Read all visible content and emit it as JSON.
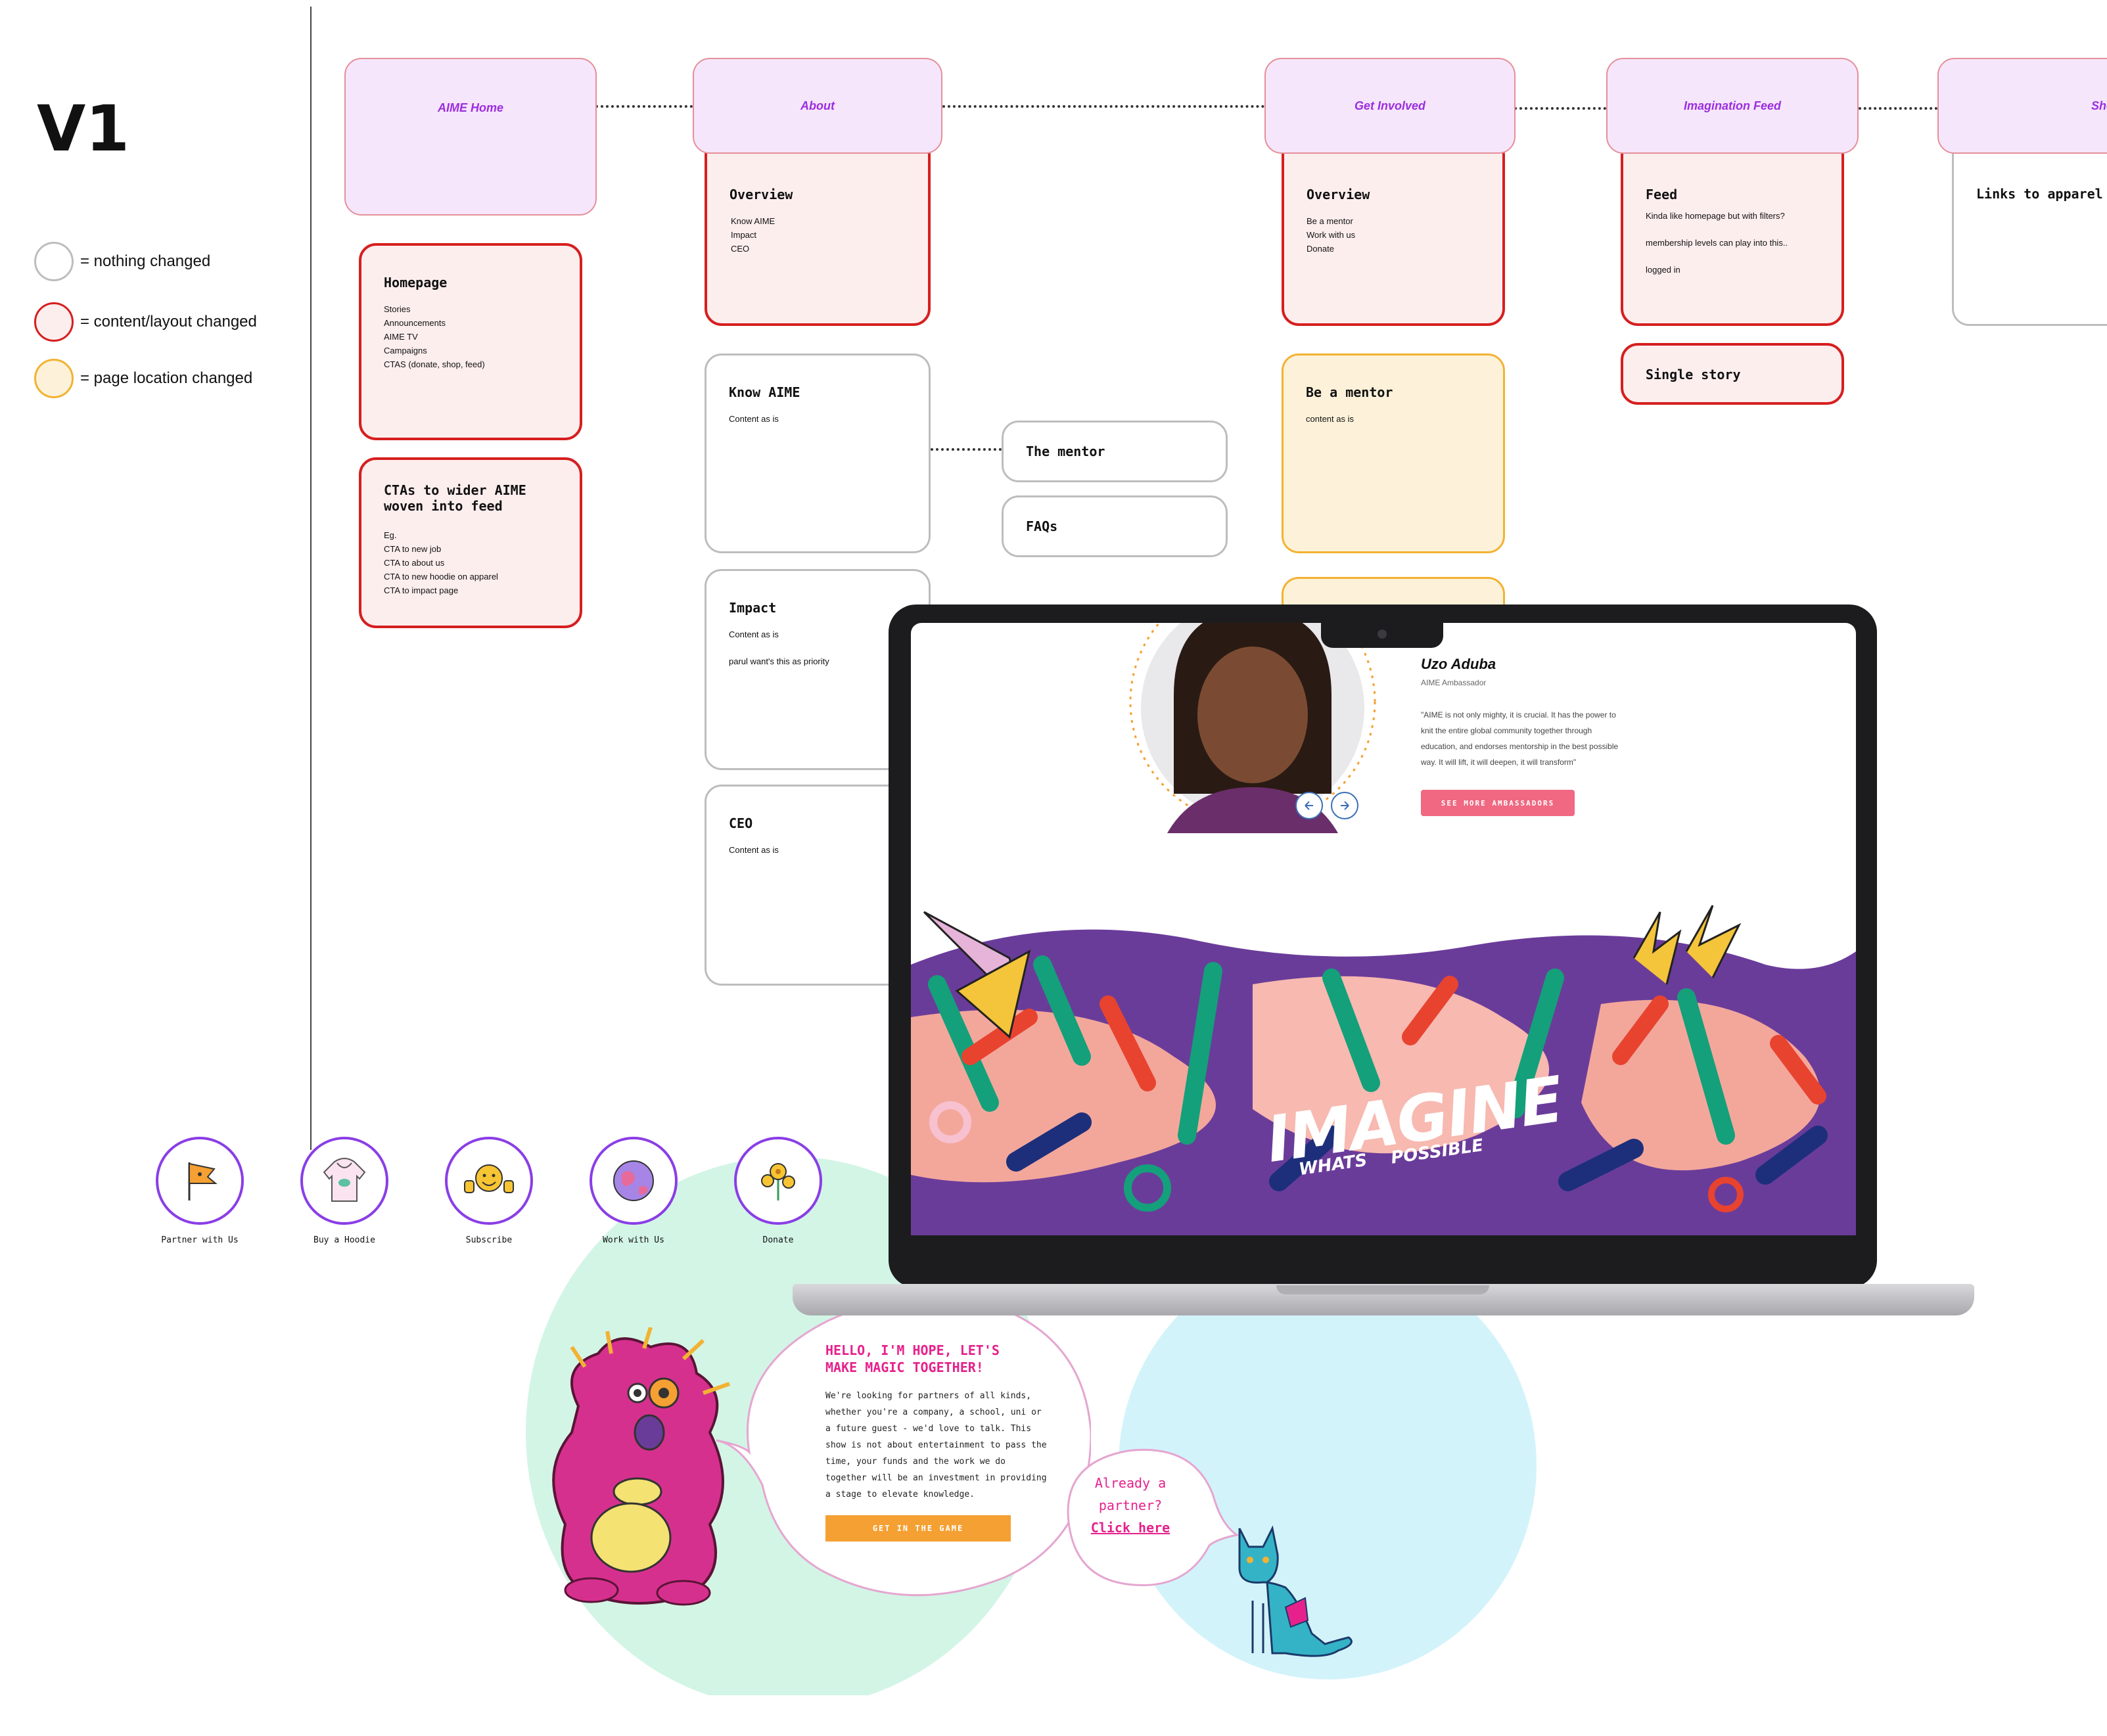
{
  "title": "V1",
  "legend": [
    {
      "label": "= nothing changed",
      "color": "#bdbdbd",
      "fill": "#ffffff"
    },
    {
      "label": "= content/layout changed",
      "color": "#d61f1f",
      "fill": "#fdeeee"
    },
    {
      "label": "= page location changed",
      "color": "#f2b233",
      "fill": "#fdf2d9"
    }
  ],
  "headers": {
    "home": "AIME Home",
    "about": "About",
    "get_involved": "Get Involved",
    "feed": "Imagination Feed",
    "shop": "Shop"
  },
  "cards": {
    "homepage": {
      "title": "Homepage",
      "lines": [
        "Stories",
        "Announcements",
        "AIME TV",
        "Campaigns",
        "CTAS (donate, shop, feed)"
      ]
    },
    "ctas": {
      "title1": "CTAs to wider AIME",
      "title2": "woven into feed",
      "lines": [
        "Eg.",
        "CTA to new job",
        "CTA to about us",
        "CTA to new hoodie on apparel",
        "CTA to impact page"
      ]
    },
    "about_overview": {
      "title": "Overview",
      "lines": [
        "Know AIME",
        "Impact",
        "CEO"
      ]
    },
    "know_aime": {
      "title": "Know AIME",
      "line": "Content as is"
    },
    "impact": {
      "title": "Impact",
      "line1": "Content as is",
      "line2": "parul want's this as priority"
    },
    "ceo": {
      "title": "CEO",
      "line": "Content as is"
    },
    "mentor": {
      "title": "The mentor"
    },
    "faqs": {
      "title": "FAQs"
    },
    "gi_overview": {
      "title": "Overview",
      "lines": [
        "Be a mentor",
        "Work with us",
        "Donate"
      ]
    },
    "be_mentor": {
      "title": "Be a mentor",
      "line": "content as is"
    },
    "feed": {
      "title": "Feed",
      "line1": "Kinda like homepage but with filters?",
      "line2": "membership levels can play into this..",
      "line3": "logged in"
    },
    "single_story": {
      "title": "Single story"
    },
    "shop_links": {
      "title": "Links to apparel sh"
    }
  },
  "ctas": [
    {
      "label": "Partner with Us",
      "icon": "flag-icon"
    },
    {
      "label": "Buy a Hoodie",
      "icon": "hoodie-icon"
    },
    {
      "label": "Subscribe",
      "icon": "smiley-thumbs-icon"
    },
    {
      "label": "Work with Us",
      "icon": "globe-icon"
    },
    {
      "label": "Donate",
      "icon": "flower-icon"
    }
  ],
  "laptop": {
    "ambassador_name": "Uzo Aduba",
    "ambassador_role": "AIME Ambassador",
    "quote_lines": [
      "\"AIME is not only mighty, it is crucial. It has the power to",
      "knit the entire global community together through",
      "education, and endorses mentorship in the best possible",
      "way. It will lift, it will deepen, it will transform\""
    ],
    "button": "SEE MORE AMBASSADORS",
    "banner_title": "IMAGINE",
    "banner_sub1": "WHATS",
    "banner_sub2": "POSSIBLE"
  },
  "bubble": {
    "title1": "HELLO, I'M HOPE, LET'S",
    "title2": "MAKE MAGIC TOGETHER!",
    "body": [
      "We're looking for partners of all kinds,",
      "whether you're a company, a school, uni or",
      "a future guest - we'd love to talk. This",
      "show is not about entertainment to pass the",
      "time, your funds and the work we do",
      "together will be an investment in providing",
      "a stage to elevate knowledge."
    ],
    "button": "GET IN THE GAME",
    "partner1": "Already a",
    "partner2": "partner?",
    "partner3": "Click here"
  },
  "colors": {
    "purple_accent": "#9b2ee0",
    "red_border": "#d61f1f",
    "yellow_border": "#f2b233",
    "pink": "#e6218c",
    "orange": "#f5a032",
    "mint": "#d3f5e6",
    "sky": "#d3f3fa"
  }
}
